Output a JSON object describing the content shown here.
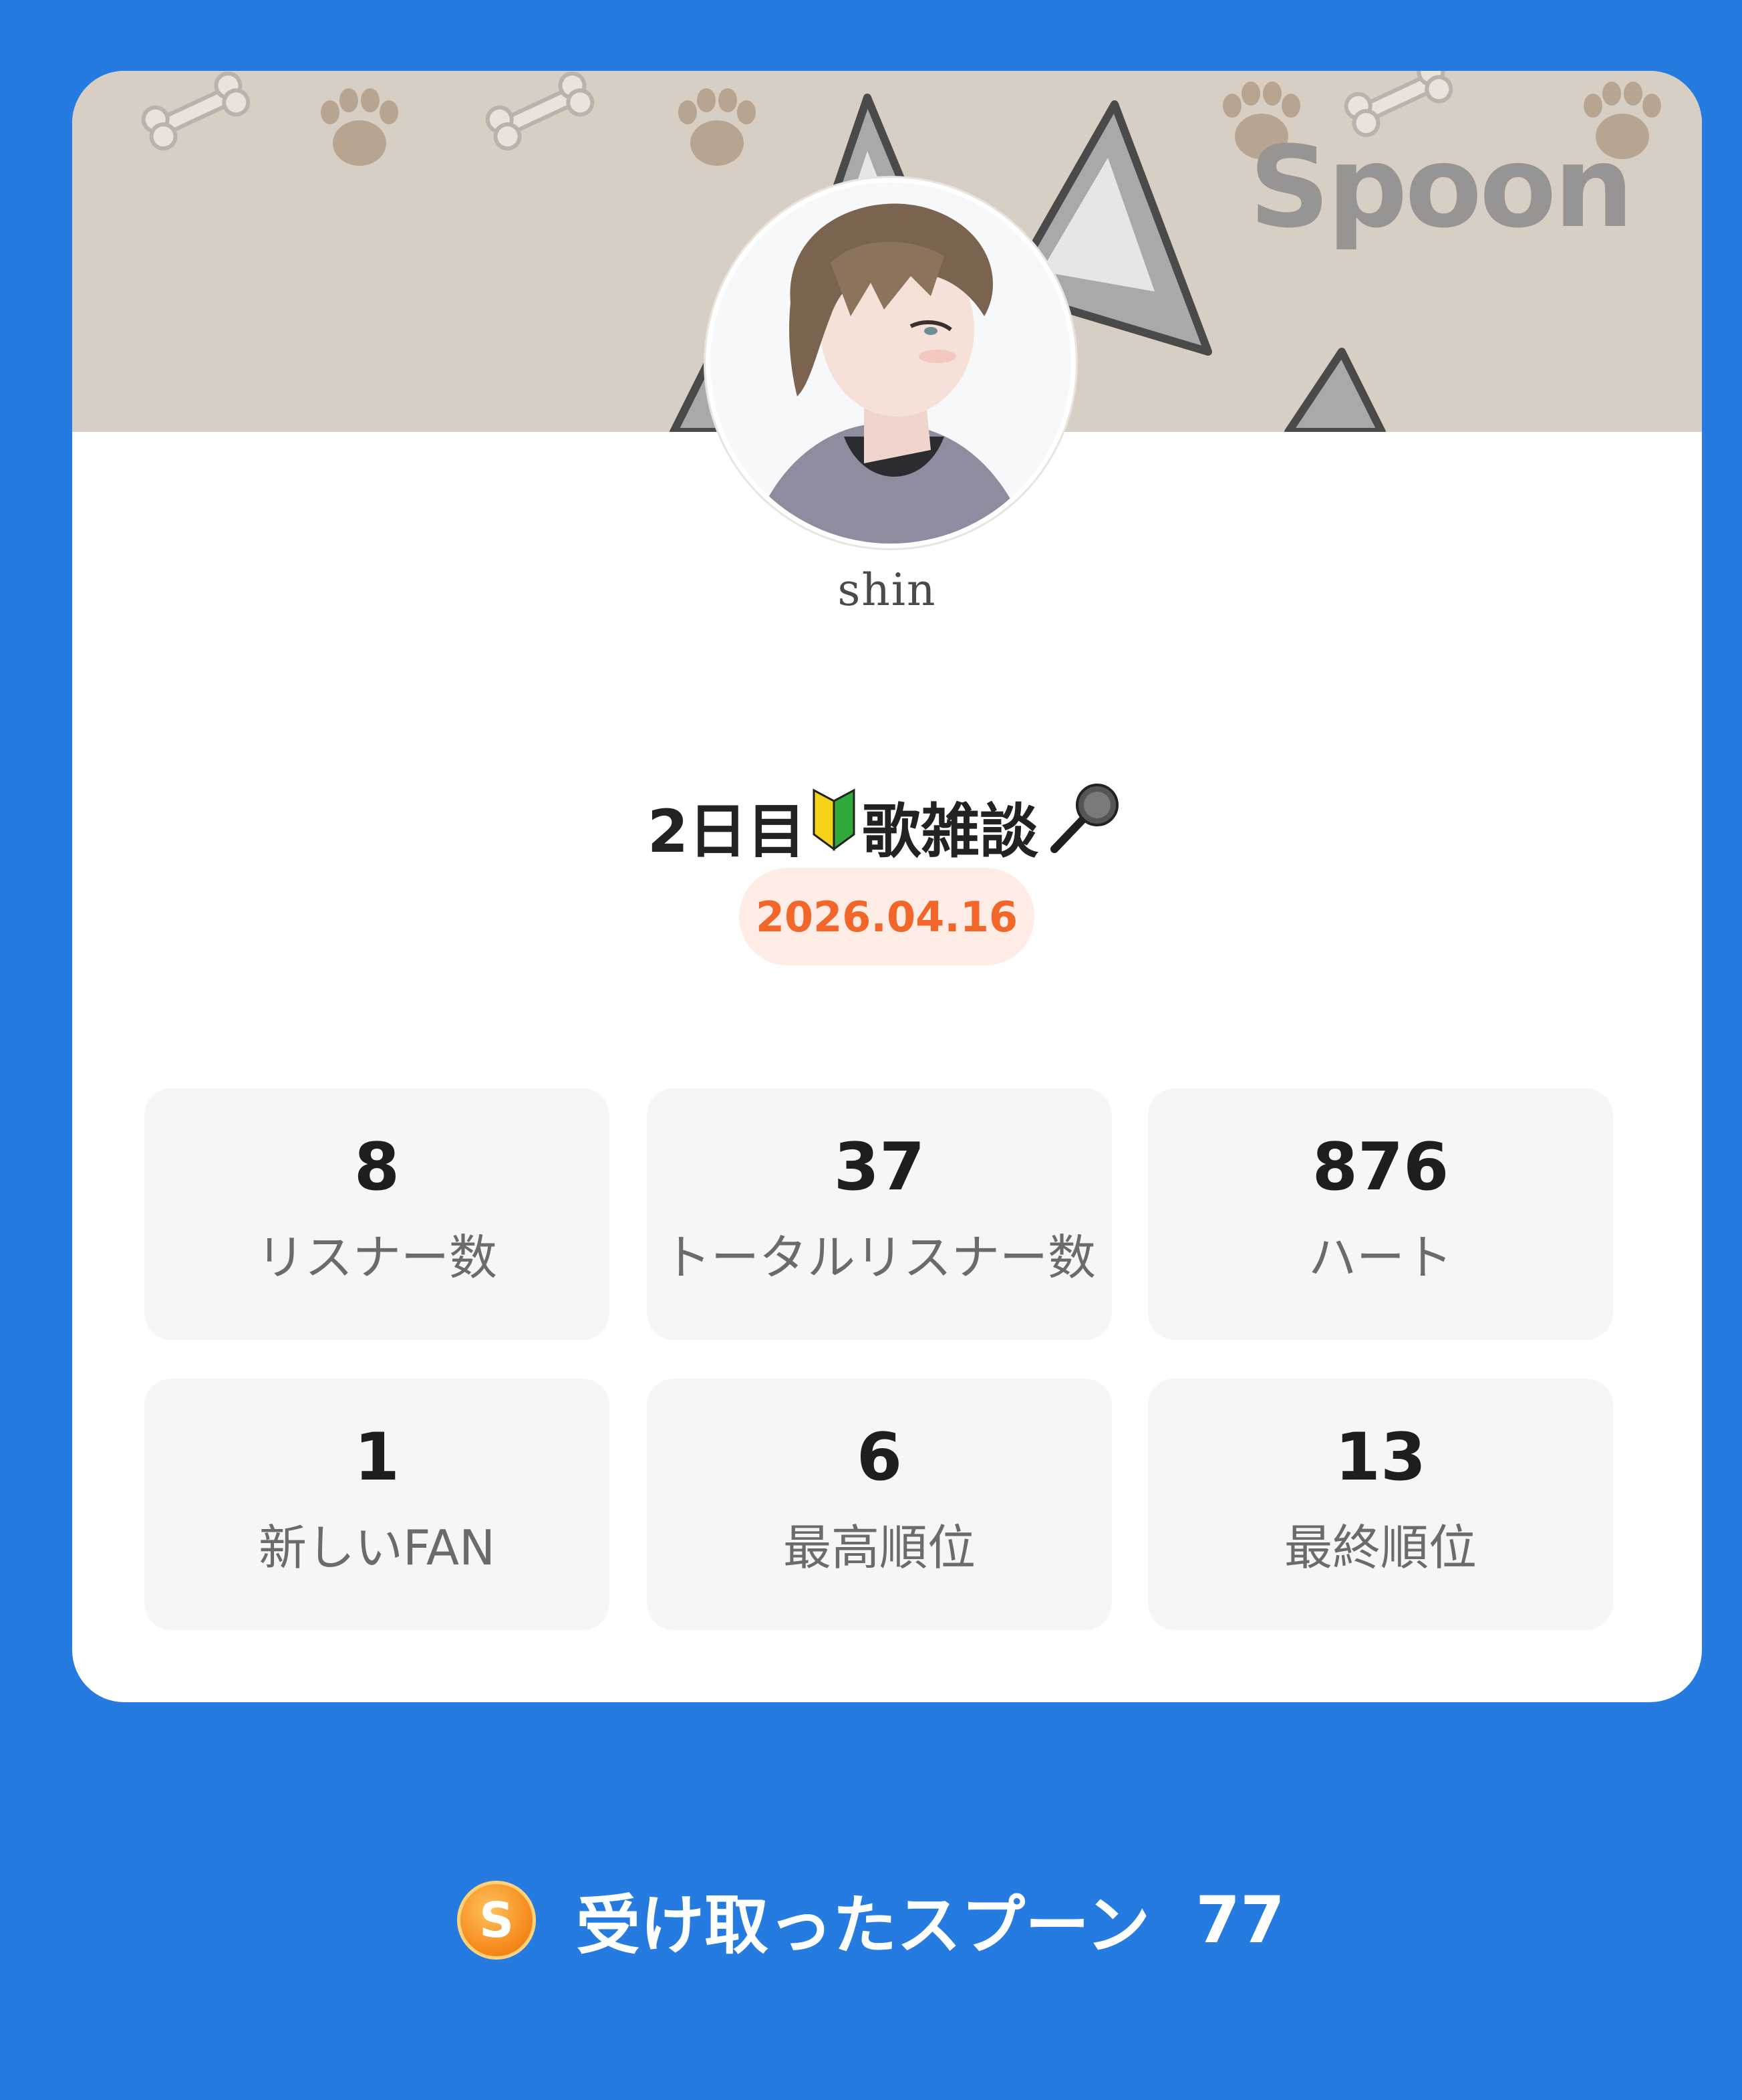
{
  "brand": "Spoon",
  "profile": {
    "username": "shin"
  },
  "broadcast": {
    "title_prefix": "2日目",
    "title_middle": "歌雑談",
    "date": "2026.04.16"
  },
  "stats": [
    {
      "value": "8",
      "label": "リスナー数"
    },
    {
      "value": "37",
      "label": "トータルリスナー数"
    },
    {
      "value": "876",
      "label": "ハート"
    },
    {
      "value": "1",
      "label": "新しいFAN"
    },
    {
      "value": "6",
      "label": "最高順位"
    },
    {
      "value": "13",
      "label": "最終順位"
    }
  ],
  "footer": {
    "coin_letter": "S",
    "label": "受け取ったスプーン",
    "amount": "77"
  },
  "icons": {
    "beginner": "beginner-mark-icon",
    "microphone": "microphone-icon",
    "spoon_coin": "spoon-coin-icon"
  },
  "colors": {
    "background": "#267be0",
    "accent": "#f2662a",
    "accent_bg": "#ffece5",
    "tile_bg": "#f6f6f6"
  }
}
